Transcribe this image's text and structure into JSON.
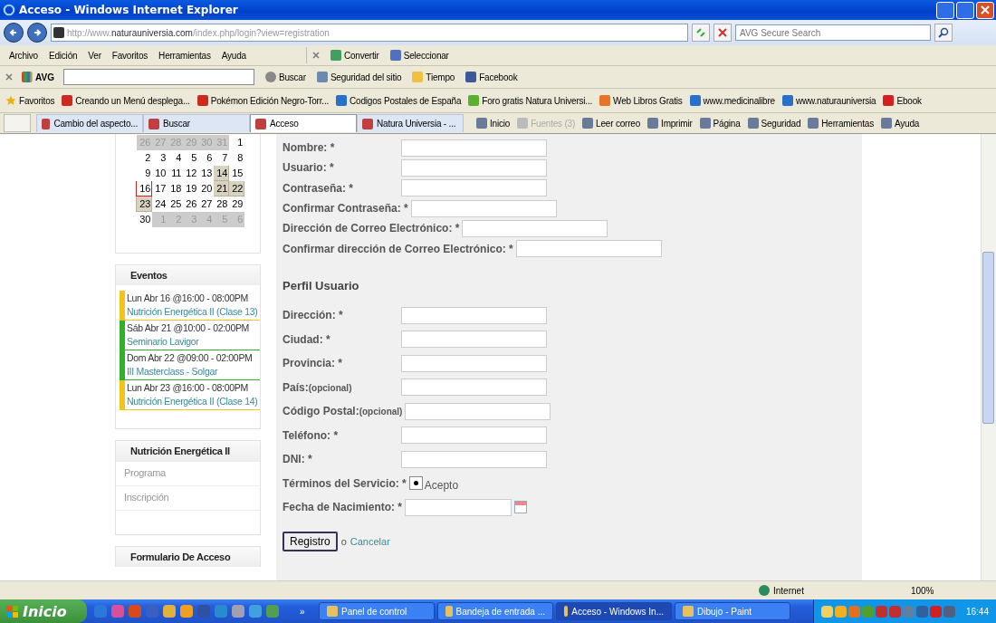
{
  "window": {
    "title": "Acceso - Windows Internet Explorer"
  },
  "address_bar": {
    "url_prefix": "http://www.",
    "url_domain": "naturauniversia.com",
    "url_path": "/index.php/login?view=registration",
    "search_placeholder": "AVG Secure Search"
  },
  "menu": [
    "Archivo",
    "Edición",
    "Ver",
    "Favoritos",
    "Herramientas",
    "Ayuda"
  ],
  "menu_extras": [
    "Convertir",
    "Seleccionar"
  ],
  "avg_toolbar": {
    "brand": "AVG",
    "search_button": "Buscar",
    "items": [
      "Seguridad del sitio",
      "Tiempo",
      "Facebook"
    ]
  },
  "favorites": {
    "label": "Favoritos",
    "links": [
      {
        "label": "Creando un Menú desplega...",
        "color": "#cc2a1f"
      },
      {
        "label": "Pokémon Edición Negro-Torr...",
        "color": "#cc2a1f"
      },
      {
        "label": "Codigos Postales de España",
        "color": "#2a6fc9"
      },
      {
        "label": "Foro gratis  Natura Universi...",
        "color": "#5cb030"
      },
      {
        "label": "Web Libros Gratis",
        "color": "#e8742a"
      },
      {
        "label": "www.medicinalibre",
        "color": "#2a6fc9"
      },
      {
        "label": "www.naturauniversia",
        "color": "#2a6fc9"
      },
      {
        "label": "Ebook",
        "color": "#d42020"
      }
    ]
  },
  "tabs": [
    {
      "label": "Cambio del aspecto...",
      "selected": false
    },
    {
      "label": "Buscar",
      "selected": false
    },
    {
      "label": "Acceso",
      "selected": true
    },
    {
      "label": "Natura Universia - ...",
      "selected": false
    }
  ],
  "command_bar": [
    {
      "label": "Inicio",
      "disabled": false
    },
    {
      "label": "Fuentes (3)",
      "disabled": true
    },
    {
      "label": "Leer correo",
      "disabled": false
    },
    {
      "label": "Imprimir",
      "disabled": false
    },
    {
      "label": "Página",
      "disabled": false
    },
    {
      "label": "Seguridad",
      "disabled": false
    },
    {
      "label": "Herramientas",
      "disabled": false
    },
    {
      "label": "Ayuda",
      "disabled": false
    }
  ],
  "calendar": {
    "weeks": [
      [
        {
          "day": "26",
          "kind": "other"
        },
        {
          "day": "27",
          "kind": "other"
        },
        {
          "day": "28",
          "kind": "other"
        },
        {
          "day": "29",
          "kind": "other"
        },
        {
          "day": "30",
          "kind": "other"
        },
        {
          "day": "31",
          "kind": "other"
        },
        {
          "day": "1",
          "kind": "day"
        }
      ],
      [
        {
          "day": "2",
          "kind": "day"
        },
        {
          "day": "3",
          "kind": "day"
        },
        {
          "day": "4",
          "kind": "day"
        },
        {
          "day": "5",
          "kind": "day"
        },
        {
          "day": "6",
          "kind": "day"
        },
        {
          "day": "7",
          "kind": "day"
        },
        {
          "day": "8",
          "kind": "day"
        }
      ],
      [
        {
          "day": "9",
          "kind": "day"
        },
        {
          "day": "10",
          "kind": "day"
        },
        {
          "day": "11",
          "kind": "day"
        },
        {
          "day": "12",
          "kind": "day"
        },
        {
          "day": "13",
          "kind": "day"
        },
        {
          "day": "14",
          "kind": "event"
        },
        {
          "day": "15",
          "kind": "day"
        }
      ],
      [
        {
          "day": "16",
          "kind": "today"
        },
        {
          "day": "17",
          "kind": "day"
        },
        {
          "day": "18",
          "kind": "day"
        },
        {
          "day": "19",
          "kind": "day"
        },
        {
          "day": "20",
          "kind": "day"
        },
        {
          "day": "21",
          "kind": "event"
        },
        {
          "day": "22",
          "kind": "event"
        }
      ],
      [
        {
          "day": "23",
          "kind": "event"
        },
        {
          "day": "24",
          "kind": "day"
        },
        {
          "day": "25",
          "kind": "day"
        },
        {
          "day": "26",
          "kind": "day"
        },
        {
          "day": "27",
          "kind": "day"
        },
        {
          "day": "28",
          "kind": "day"
        },
        {
          "day": "29",
          "kind": "day"
        }
      ],
      [
        {
          "day": "30",
          "kind": "day"
        },
        {
          "day": "1",
          "kind": "other"
        },
        {
          "day": "2",
          "kind": "other"
        },
        {
          "day": "3",
          "kind": "other"
        },
        {
          "day": "4",
          "kind": "other"
        },
        {
          "day": "5",
          "kind": "other"
        },
        {
          "day": "6",
          "kind": "other"
        }
      ]
    ]
  },
  "events": {
    "title": "Eventos",
    "items": [
      {
        "when": "Lun Abr 16 @16:00 - 08:00PM",
        "title": "Nutrición Energética II (Clase 13)",
        "color": "#f0c419"
      },
      {
        "when": "Sáb Abr 21 @10:00 - 02:00PM",
        "title": "Seminario Lavigor",
        "color": "#33b02a"
      },
      {
        "when": "Dom Abr 22 @09:00 - 02:00PM",
        "title": "III Masterclass - Solgar",
        "color": "#33b02a"
      },
      {
        "when": "Lun Abr 23 @16:00 - 08:00PM",
        "title": "Nutrición Energética II (Clase 14)",
        "color": "#f0c419"
      }
    ]
  },
  "course_module": {
    "title": "Nutrición Energética II",
    "links": [
      "Programa",
      "Inscripción"
    ]
  },
  "login_module": {
    "title": "Formulario De Acceso"
  },
  "form": {
    "fields": [
      {
        "kind": "text",
        "label": "Nombre: *"
      },
      {
        "kind": "text",
        "label": "Usuario: *"
      },
      {
        "kind": "text",
        "label": "Contraseña: *"
      },
      {
        "kind": "text",
        "label": "Confirmar Contraseña: *"
      },
      {
        "kind": "text",
        "label": "Dirección de Correo Electrónico: *"
      },
      {
        "kind": "text",
        "label": "Confirmar dirección de Correo Electrónico: *"
      },
      {
        "kind": "heading",
        "label": "Perfil Usuario"
      },
      {
        "kind": "text",
        "label": "Dirección: *"
      },
      {
        "kind": "text",
        "label": "Ciudad: *"
      },
      {
        "kind": "text",
        "label": "Provincia: *"
      },
      {
        "kind": "text",
        "label": "País:",
        "note": "(opcional)"
      },
      {
        "kind": "text",
        "label": "Código Postal:",
        "note": "(opcional)"
      },
      {
        "kind": "text",
        "label": "Teléfono: *"
      },
      {
        "kind": "text",
        "label": "DNI: *"
      },
      {
        "kind": "radio",
        "label": "Términos del Servicio: *",
        "option": "Acepto",
        "checked": true
      },
      {
        "kind": "date",
        "label": "Fecha de Nacimiento: *"
      }
    ],
    "submit": "Registro",
    "separator": "o",
    "cancel": "Cancelar"
  },
  "status_bar": {
    "zone": "Internet",
    "zoom": "100%"
  },
  "taskbar": {
    "start": "Inicio",
    "more": "»",
    "tasks": [
      {
        "label": "Panel de control",
        "selected": false
      },
      {
        "label": "Bandeja de entrada ...",
        "selected": false
      },
      {
        "label": "Acceso - Windows In...",
        "selected": true
      },
      {
        "label": "Dibujo - Paint",
        "selected": false
      }
    ],
    "clock": "16:44"
  }
}
